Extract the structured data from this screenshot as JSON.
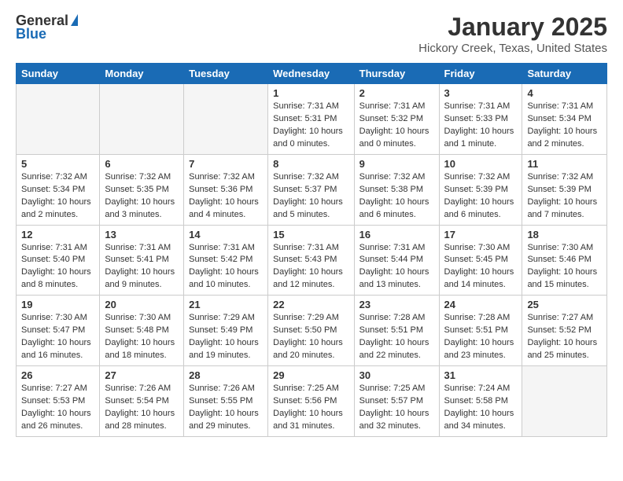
{
  "header": {
    "logo_general": "General",
    "logo_blue": "Blue",
    "title": "January 2025",
    "subtitle": "Hickory Creek, Texas, United States"
  },
  "weekdays": [
    "Sunday",
    "Monday",
    "Tuesday",
    "Wednesday",
    "Thursday",
    "Friday",
    "Saturday"
  ],
  "weeks": [
    {
      "days": [
        {
          "num": "",
          "empty": true
        },
        {
          "num": "",
          "empty": true
        },
        {
          "num": "",
          "empty": true
        },
        {
          "num": "1",
          "sunrise": "7:31 AM",
          "sunset": "5:31 PM",
          "daylight": "10 hours and 0 minutes."
        },
        {
          "num": "2",
          "sunrise": "7:31 AM",
          "sunset": "5:32 PM",
          "daylight": "10 hours and 0 minutes."
        },
        {
          "num": "3",
          "sunrise": "7:31 AM",
          "sunset": "5:33 PM",
          "daylight": "10 hours and 1 minute."
        },
        {
          "num": "4",
          "sunrise": "7:31 AM",
          "sunset": "5:34 PM",
          "daylight": "10 hours and 2 minutes."
        }
      ]
    },
    {
      "days": [
        {
          "num": "5",
          "sunrise": "7:32 AM",
          "sunset": "5:34 PM",
          "daylight": "10 hours and 2 minutes."
        },
        {
          "num": "6",
          "sunrise": "7:32 AM",
          "sunset": "5:35 PM",
          "daylight": "10 hours and 3 minutes."
        },
        {
          "num": "7",
          "sunrise": "7:32 AM",
          "sunset": "5:36 PM",
          "daylight": "10 hours and 4 minutes."
        },
        {
          "num": "8",
          "sunrise": "7:32 AM",
          "sunset": "5:37 PM",
          "daylight": "10 hours and 5 minutes."
        },
        {
          "num": "9",
          "sunrise": "7:32 AM",
          "sunset": "5:38 PM",
          "daylight": "10 hours and 6 minutes."
        },
        {
          "num": "10",
          "sunrise": "7:32 AM",
          "sunset": "5:39 PM",
          "daylight": "10 hours and 6 minutes."
        },
        {
          "num": "11",
          "sunrise": "7:32 AM",
          "sunset": "5:39 PM",
          "daylight": "10 hours and 7 minutes."
        }
      ]
    },
    {
      "days": [
        {
          "num": "12",
          "sunrise": "7:31 AM",
          "sunset": "5:40 PM",
          "daylight": "10 hours and 8 minutes."
        },
        {
          "num": "13",
          "sunrise": "7:31 AM",
          "sunset": "5:41 PM",
          "daylight": "10 hours and 9 minutes."
        },
        {
          "num": "14",
          "sunrise": "7:31 AM",
          "sunset": "5:42 PM",
          "daylight": "10 hours and 10 minutes."
        },
        {
          "num": "15",
          "sunrise": "7:31 AM",
          "sunset": "5:43 PM",
          "daylight": "10 hours and 12 minutes."
        },
        {
          "num": "16",
          "sunrise": "7:31 AM",
          "sunset": "5:44 PM",
          "daylight": "10 hours and 13 minutes."
        },
        {
          "num": "17",
          "sunrise": "7:30 AM",
          "sunset": "5:45 PM",
          "daylight": "10 hours and 14 minutes."
        },
        {
          "num": "18",
          "sunrise": "7:30 AM",
          "sunset": "5:46 PM",
          "daylight": "10 hours and 15 minutes."
        }
      ]
    },
    {
      "days": [
        {
          "num": "19",
          "sunrise": "7:30 AM",
          "sunset": "5:47 PM",
          "daylight": "10 hours and 16 minutes."
        },
        {
          "num": "20",
          "sunrise": "7:30 AM",
          "sunset": "5:48 PM",
          "daylight": "10 hours and 18 minutes."
        },
        {
          "num": "21",
          "sunrise": "7:29 AM",
          "sunset": "5:49 PM",
          "daylight": "10 hours and 19 minutes."
        },
        {
          "num": "22",
          "sunrise": "7:29 AM",
          "sunset": "5:50 PM",
          "daylight": "10 hours and 20 minutes."
        },
        {
          "num": "23",
          "sunrise": "7:28 AM",
          "sunset": "5:51 PM",
          "daylight": "10 hours and 22 minutes."
        },
        {
          "num": "24",
          "sunrise": "7:28 AM",
          "sunset": "5:51 PM",
          "daylight": "10 hours and 23 minutes."
        },
        {
          "num": "25",
          "sunrise": "7:27 AM",
          "sunset": "5:52 PM",
          "daylight": "10 hours and 25 minutes."
        }
      ]
    },
    {
      "days": [
        {
          "num": "26",
          "sunrise": "7:27 AM",
          "sunset": "5:53 PM",
          "daylight": "10 hours and 26 minutes."
        },
        {
          "num": "27",
          "sunrise": "7:26 AM",
          "sunset": "5:54 PM",
          "daylight": "10 hours and 28 minutes."
        },
        {
          "num": "28",
          "sunrise": "7:26 AM",
          "sunset": "5:55 PM",
          "daylight": "10 hours and 29 minutes."
        },
        {
          "num": "29",
          "sunrise": "7:25 AM",
          "sunset": "5:56 PM",
          "daylight": "10 hours and 31 minutes."
        },
        {
          "num": "30",
          "sunrise": "7:25 AM",
          "sunset": "5:57 PM",
          "daylight": "10 hours and 32 minutes."
        },
        {
          "num": "31",
          "sunrise": "7:24 AM",
          "sunset": "5:58 PM",
          "daylight": "10 hours and 34 minutes."
        },
        {
          "num": "",
          "empty": true
        }
      ]
    }
  ]
}
